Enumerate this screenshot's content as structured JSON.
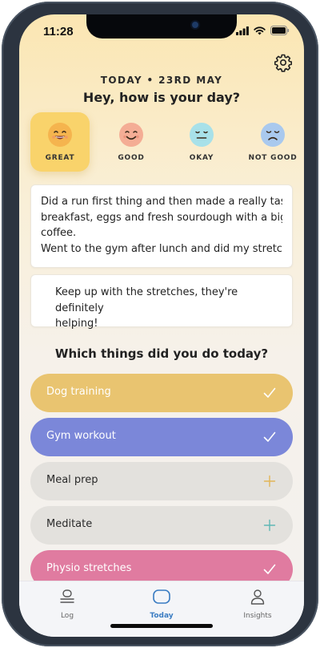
{
  "status": {
    "time": "11:28"
  },
  "header": {
    "date": "TODAY • 23RD MAY",
    "greeting": "Hey, how is your day?",
    "settings_icon": "gear-icon"
  },
  "moods": [
    {
      "label": "GREAT",
      "color": "#f5b44e",
      "face": "grinning",
      "selected": true
    },
    {
      "label": "GOOD",
      "color": "#f4ad95",
      "face": "smiling",
      "selected": false
    },
    {
      "label": "OKAY",
      "color": "#a8e1e9",
      "face": "neutral",
      "selected": false
    },
    {
      "label": "NOT GOOD",
      "color": "#a9c9ee",
      "face": "sad",
      "selected": false
    }
  ],
  "journal": {
    "lines": [
      "Did a run first thing and then made a really tasty",
      "breakfast, eggs and fresh sourdough with a big",
      "coffee.",
      "Went to the gym after lunch and did my stretches..."
    ]
  },
  "note": {
    "lines": [
      "Keep up with the stretches, they're definitely",
      "helping!"
    ]
  },
  "activities_title": "Which things did you do today?",
  "activities": [
    {
      "label": "Dog training",
      "color": "#e9c470",
      "done": true
    },
    {
      "label": "Gym workout",
      "color": "#7b87d9",
      "done": true
    },
    {
      "label": "Meal prep",
      "color": "#e3e1dd",
      "done": false,
      "plus_color": "#e2b657"
    },
    {
      "label": "Meditate",
      "color": "#e3e1dd",
      "done": false,
      "plus_color": "#5fb7b5"
    },
    {
      "label": "Physio stretches",
      "color": "#e07ba0",
      "done": true
    }
  ],
  "tabs": [
    {
      "label": "Log",
      "active": false
    },
    {
      "label": "Today",
      "active": true
    },
    {
      "label": "Insights",
      "active": false
    }
  ]
}
